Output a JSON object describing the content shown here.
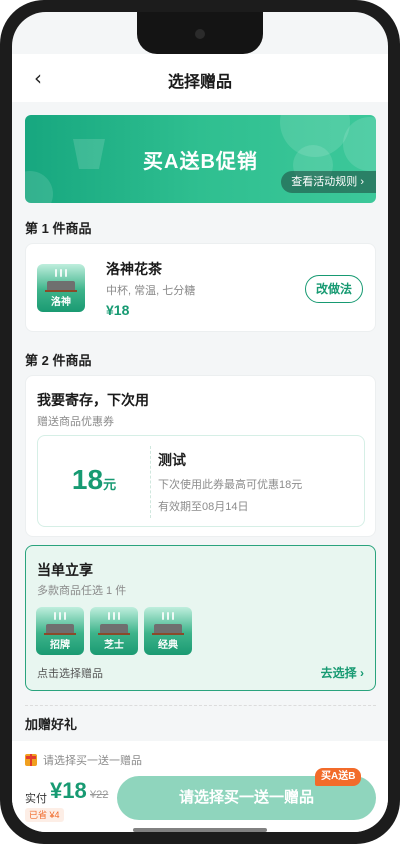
{
  "nav": {
    "back_icon": "chevron-left-icon",
    "back_glyph": "‹",
    "title": "选择赠品"
  },
  "banner": {
    "title": "买A送B促销",
    "rules_label": "查看活动规则 ›"
  },
  "section1": {
    "title": "第 1 件商品",
    "product": {
      "thumb_label": "洛神",
      "name": "洛神花茶",
      "spec": "中杯, 常温, 七分糖",
      "price": "¥18",
      "change_label": "改做法"
    }
  },
  "section2": {
    "title": "第 2 件商品",
    "store": {
      "title": "我要寄存，下次用",
      "subtitle": "赠送商品优惠券",
      "coupon": {
        "amount": "18",
        "unit": "元",
        "name": "测试",
        "desc": "下次使用此券最高可优惠18元",
        "expiry": "有效期至08月14日"
      }
    },
    "instant": {
      "title": "当单立享",
      "subtitle": "多款商品任选 1 件",
      "gifts": [
        {
          "label": "招牌"
        },
        {
          "label": "芝士"
        },
        {
          "label": "经典"
        }
      ],
      "hint": "点击选择赠品",
      "choose_label": "去选择 ›"
    }
  },
  "section3": {
    "title": "加赠好礼"
  },
  "bottom": {
    "tip_icon": "gift-icon",
    "tip": "请选择买一送一赠品",
    "pay_label": "实付",
    "pay_amount": "¥18",
    "original": "¥22",
    "saved": "已省 ¥4",
    "promo_tag": "买A送B",
    "submit_label": "请选择买一送一赠品"
  },
  "colors": {
    "brand": "#179a72",
    "accent": "#f26b2a",
    "submit_bg": "#8fd5bd"
  }
}
